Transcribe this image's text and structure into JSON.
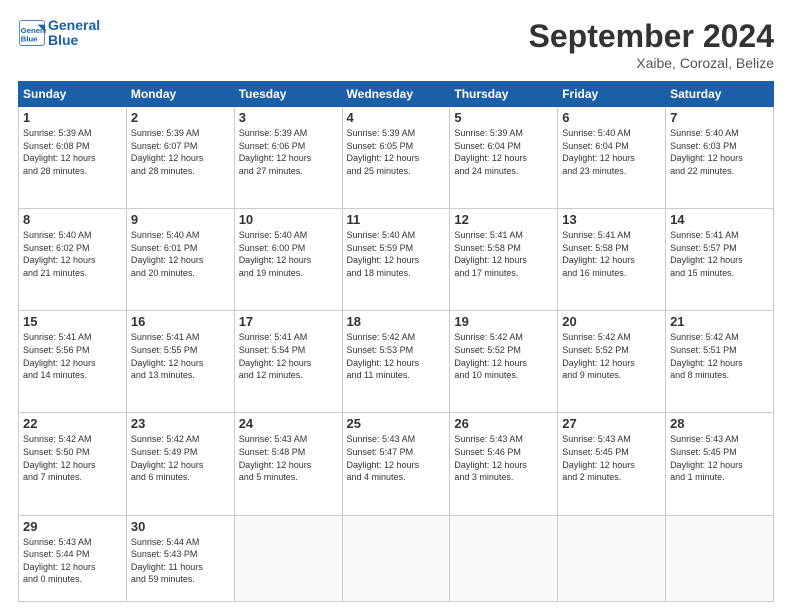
{
  "header": {
    "logo_line1": "General",
    "logo_line2": "Blue",
    "month_title": "September 2024",
    "location": "Xaibe, Corozal, Belize"
  },
  "days_of_week": [
    "Sunday",
    "Monday",
    "Tuesday",
    "Wednesday",
    "Thursday",
    "Friday",
    "Saturday"
  ],
  "weeks": [
    [
      {
        "day": "1",
        "info": "Sunrise: 5:39 AM\nSunset: 6:08 PM\nDaylight: 12 hours\nand 28 minutes."
      },
      {
        "day": "2",
        "info": "Sunrise: 5:39 AM\nSunset: 6:07 PM\nDaylight: 12 hours\nand 28 minutes."
      },
      {
        "day": "3",
        "info": "Sunrise: 5:39 AM\nSunset: 6:06 PM\nDaylight: 12 hours\nand 27 minutes."
      },
      {
        "day": "4",
        "info": "Sunrise: 5:39 AM\nSunset: 6:05 PM\nDaylight: 12 hours\nand 25 minutes."
      },
      {
        "day": "5",
        "info": "Sunrise: 5:39 AM\nSunset: 6:04 PM\nDaylight: 12 hours\nand 24 minutes."
      },
      {
        "day": "6",
        "info": "Sunrise: 5:40 AM\nSunset: 6:04 PM\nDaylight: 12 hours\nand 23 minutes."
      },
      {
        "day": "7",
        "info": "Sunrise: 5:40 AM\nSunset: 6:03 PM\nDaylight: 12 hours\nand 22 minutes."
      }
    ],
    [
      {
        "day": "8",
        "info": "Sunrise: 5:40 AM\nSunset: 6:02 PM\nDaylight: 12 hours\nand 21 minutes."
      },
      {
        "day": "9",
        "info": "Sunrise: 5:40 AM\nSunset: 6:01 PM\nDaylight: 12 hours\nand 20 minutes."
      },
      {
        "day": "10",
        "info": "Sunrise: 5:40 AM\nSunset: 6:00 PM\nDaylight: 12 hours\nand 19 minutes."
      },
      {
        "day": "11",
        "info": "Sunrise: 5:40 AM\nSunset: 5:59 PM\nDaylight: 12 hours\nand 18 minutes."
      },
      {
        "day": "12",
        "info": "Sunrise: 5:41 AM\nSunset: 5:58 PM\nDaylight: 12 hours\nand 17 minutes."
      },
      {
        "day": "13",
        "info": "Sunrise: 5:41 AM\nSunset: 5:58 PM\nDaylight: 12 hours\nand 16 minutes."
      },
      {
        "day": "14",
        "info": "Sunrise: 5:41 AM\nSunset: 5:57 PM\nDaylight: 12 hours\nand 15 minutes."
      }
    ],
    [
      {
        "day": "15",
        "info": "Sunrise: 5:41 AM\nSunset: 5:56 PM\nDaylight: 12 hours\nand 14 minutes."
      },
      {
        "day": "16",
        "info": "Sunrise: 5:41 AM\nSunset: 5:55 PM\nDaylight: 12 hours\nand 13 minutes."
      },
      {
        "day": "17",
        "info": "Sunrise: 5:41 AM\nSunset: 5:54 PM\nDaylight: 12 hours\nand 12 minutes."
      },
      {
        "day": "18",
        "info": "Sunrise: 5:42 AM\nSunset: 5:53 PM\nDaylight: 12 hours\nand 11 minutes."
      },
      {
        "day": "19",
        "info": "Sunrise: 5:42 AM\nSunset: 5:52 PM\nDaylight: 12 hours\nand 10 minutes."
      },
      {
        "day": "20",
        "info": "Sunrise: 5:42 AM\nSunset: 5:52 PM\nDaylight: 12 hours\nand 9 minutes."
      },
      {
        "day": "21",
        "info": "Sunrise: 5:42 AM\nSunset: 5:51 PM\nDaylight: 12 hours\nand 8 minutes."
      }
    ],
    [
      {
        "day": "22",
        "info": "Sunrise: 5:42 AM\nSunset: 5:50 PM\nDaylight: 12 hours\nand 7 minutes."
      },
      {
        "day": "23",
        "info": "Sunrise: 5:42 AM\nSunset: 5:49 PM\nDaylight: 12 hours\nand 6 minutes."
      },
      {
        "day": "24",
        "info": "Sunrise: 5:43 AM\nSunset: 5:48 PM\nDaylight: 12 hours\nand 5 minutes."
      },
      {
        "day": "25",
        "info": "Sunrise: 5:43 AM\nSunset: 5:47 PM\nDaylight: 12 hours\nand 4 minutes."
      },
      {
        "day": "26",
        "info": "Sunrise: 5:43 AM\nSunset: 5:46 PM\nDaylight: 12 hours\nand 3 minutes."
      },
      {
        "day": "27",
        "info": "Sunrise: 5:43 AM\nSunset: 5:45 PM\nDaylight: 12 hours\nand 2 minutes."
      },
      {
        "day": "28",
        "info": "Sunrise: 5:43 AM\nSunset: 5:45 PM\nDaylight: 12 hours\nand 1 minute."
      }
    ],
    [
      {
        "day": "29",
        "info": "Sunrise: 5:43 AM\nSunset: 5:44 PM\nDaylight: 12 hours\nand 0 minutes."
      },
      {
        "day": "30",
        "info": "Sunrise: 5:44 AM\nSunset: 5:43 PM\nDaylight: 11 hours\nand 59 minutes."
      },
      {
        "day": "",
        "info": ""
      },
      {
        "day": "",
        "info": ""
      },
      {
        "day": "",
        "info": ""
      },
      {
        "day": "",
        "info": ""
      },
      {
        "day": "",
        "info": ""
      }
    ]
  ]
}
